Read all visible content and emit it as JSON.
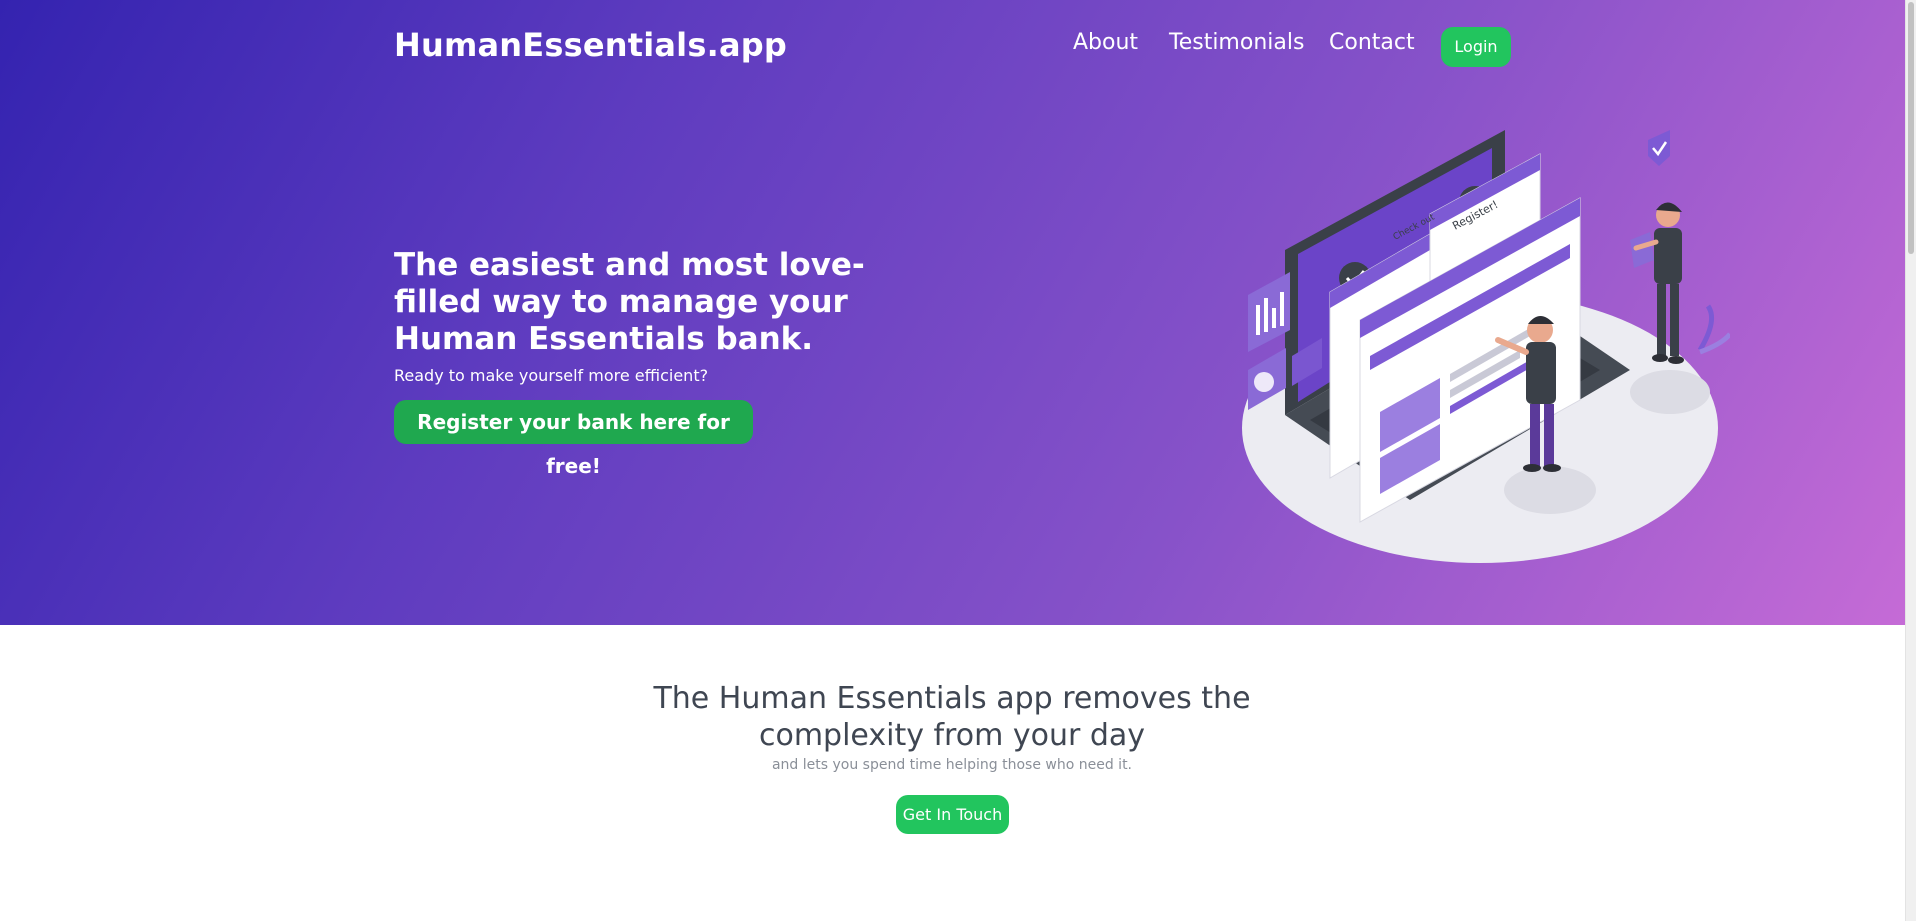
{
  "header": {
    "brand": "HumanEssentials.app",
    "nav": {
      "about": "About",
      "testimonials": "Testimonials",
      "contact": "Contact"
    },
    "login_label": "Login"
  },
  "hero": {
    "headline": "The easiest and most love-filled way to manage your Human Essentials bank.",
    "subtitle": "Ready to make yourself more efficient?",
    "cta_label": "Register your bank here for free!",
    "illustration": {
      "icon": "people-managing-bank-on-laptop-illustration",
      "window_labels": [
        "Register!",
        "Check out"
      ]
    }
  },
  "features": {
    "title": "The Human Essentials app removes the complexity from your day",
    "subtitle": "and lets you spend time helping those who need it.",
    "cta_label": "Get In Touch"
  },
  "colors": {
    "gradient_start": "#3423b0",
    "gradient_end": "#c56bd6",
    "accent_green": "#22c55e",
    "register_green": "#1fa84f",
    "text_dark": "#3f4652",
    "text_muted": "#8a8f98"
  }
}
